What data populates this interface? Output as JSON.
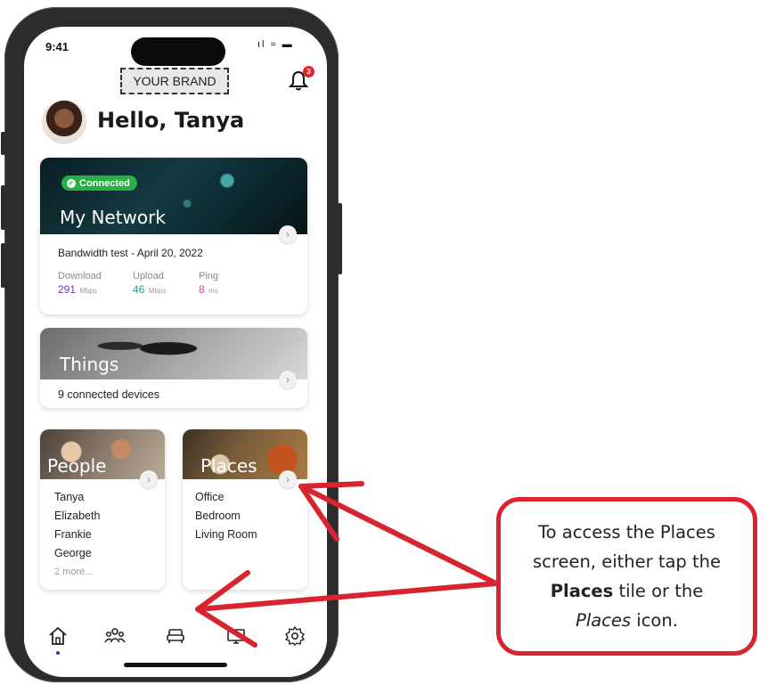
{
  "status_bar": {
    "time": "9:41",
    "icons": "ıl ≈ ▬"
  },
  "brand": {
    "label": "YOUR BRAND"
  },
  "notifications": {
    "badge": "3"
  },
  "greeting": "Hello, Tanya",
  "network_card": {
    "badge": "Connected",
    "title": "My Network",
    "bandwidth_title": "Bandwidth test - April 20, 2022",
    "download": {
      "label": "Download",
      "value": "291",
      "unit": "Mbps",
      "color": "#7a35c0"
    },
    "upload": {
      "label": "Upload",
      "value": "46",
      "unit": "Mbps",
      "color": "#23a0a0"
    },
    "ping": {
      "label": "Ping",
      "value": "8",
      "unit": "ms",
      "color": "#d04a9a"
    }
  },
  "things_card": {
    "title": "Things",
    "subtitle": "9 connected devices"
  },
  "people_card": {
    "title": "People",
    "items": [
      "Tanya",
      "Elizabeth",
      "Frankie",
      "George"
    ],
    "more": "2 more..."
  },
  "places_card": {
    "title": "Places",
    "items": [
      "Office",
      "Bedroom",
      "Living Room"
    ]
  },
  "tabbar": {
    "icons": [
      "home-icon",
      "people-icon",
      "places-icon",
      "things-icon",
      "settings-icon"
    ]
  },
  "callout": {
    "line1": "To access the Places",
    "line2": "screen, either tap the",
    "line3_bold": "Places",
    "line3_rest": " tile or the",
    "line4_italic": "Places",
    "line4_rest": " icon.",
    "color": "#d9232e"
  }
}
